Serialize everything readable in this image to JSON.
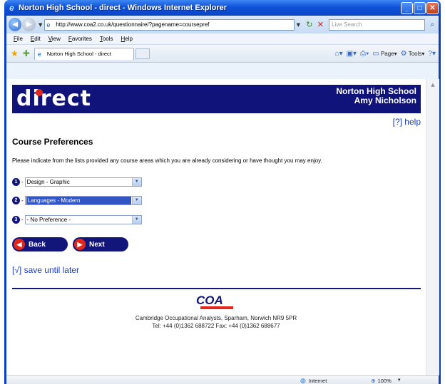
{
  "window": {
    "title": "Norton High School - direct - Windows Internet Explorer"
  },
  "browser": {
    "url": "http://www.coa2.co.uk/questionnaire/?pagename=coursepref",
    "search_placeholder": "Live Search",
    "tab_title": "Norton High School - direct",
    "menu": [
      "File",
      "Edit",
      "View",
      "Favorites",
      "Tools",
      "Help"
    ],
    "commands": {
      "page": "Page",
      "tools": "Tools"
    },
    "status": {
      "zone": "Internet",
      "zoom": "100%"
    }
  },
  "banner": {
    "logo": "direct",
    "school": "Norton High School",
    "student": "Amy Nicholson"
  },
  "help": "[?] help",
  "page": {
    "title": "Course Preferences",
    "intro": "Please indicate from the lists provided any course areas which you are already considering or have thought you may enjoy."
  },
  "preferences": [
    {
      "number": "1",
      "value": "Design - Graphic"
    },
    {
      "number": "2",
      "value": "Languages - Modern"
    },
    {
      "number": "3",
      "value": "- No Preference -"
    }
  ],
  "buttons": {
    "back": "Back",
    "next": "Next"
  },
  "save_link": "[√] save until later",
  "footer": {
    "logo": "COA",
    "address": "Cambridge Occupational Analysts, Sparham, Norwich NR9 5PR",
    "phone": "Tel: +44 (0)1362 688722   Fax: +44 (0)1362 688677"
  }
}
